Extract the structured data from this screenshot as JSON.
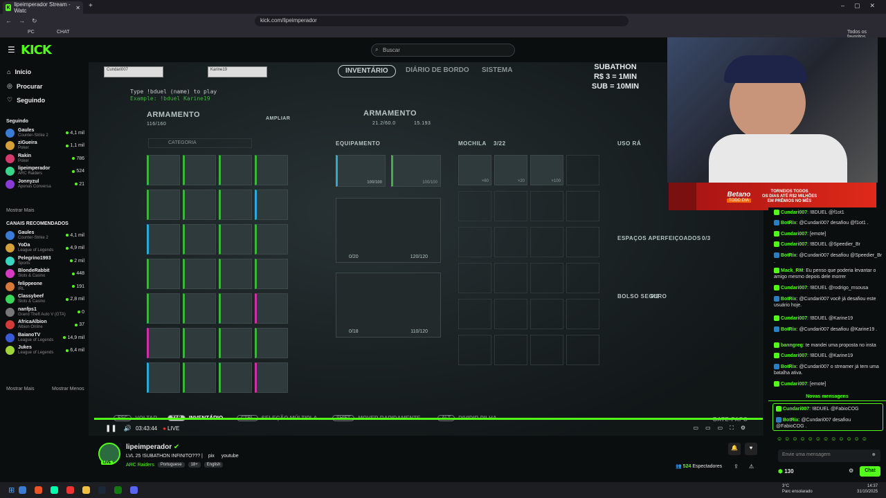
{
  "browser": {
    "tab_title": "lipeimperador Stream - Watc",
    "url": "kick.com/lipeimperador",
    "favorites": "Todos os favoritos",
    "bookmarks": [
      "PC",
      "CHAT"
    ]
  },
  "header": {
    "logo": "KICK",
    "search_placeholder": "Buscar"
  },
  "nav": [
    {
      "label": "Início",
      "icon": "home-icon"
    },
    {
      "label": "Procurar",
      "icon": "compass-icon"
    },
    {
      "label": "Seguindo",
      "icon": "heart-icon"
    }
  ],
  "following_title": "Seguindo",
  "following": [
    {
      "name": "Gaules",
      "game": "Counter-Strike 2",
      "viewers": "4,1 mil",
      "color": "#3a7bd5"
    },
    {
      "name": "ziGueira",
      "game": "Poker",
      "viewers": "1,1 mil",
      "color": "#d5a03a"
    },
    {
      "name": "Rakin",
      "game": "Poker",
      "viewers": "786",
      "color": "#d53a6a"
    },
    {
      "name": "lipeimperador",
      "game": "ARC Raiders",
      "viewers": "524",
      "color": "#3ad58a"
    },
    {
      "name": "Jonnyzul",
      "game": "Apenas Conversa",
      "viewers": "21",
      "color": "#8a3ad5"
    }
  ],
  "show_more": "Mostrar Mais",
  "recommended_title": "CANAIS RECOMENDADOS",
  "recommended": [
    {
      "name": "Gaules",
      "game": "Counter-Strike 2",
      "viewers": "4,1 mil",
      "color": "#3a7bd5"
    },
    {
      "name": "YoDa",
      "game": "League of Legends",
      "viewers": "4,9 mil",
      "color": "#d5a03a"
    },
    {
      "name": "Pelegrino1993",
      "game": "Sports",
      "viewers": "2 mil",
      "color": "#3ad5c0"
    },
    {
      "name": "BlondeRabbit",
      "game": "Slots & Casino",
      "viewers": "448",
      "color": "#d53ac0"
    },
    {
      "name": "felippeone",
      "game": "IRL",
      "viewers": "191",
      "color": "#d57a3a"
    },
    {
      "name": "Classybeef",
      "game": "Slots & Casino",
      "viewers": "2,8 mil",
      "color": "#3ad55a"
    },
    {
      "name": "nanfps1",
      "game": "Grand Theft Auto V (GTA)",
      "viewers": "0",
      "color": "#777777"
    },
    {
      "name": "AfricaAlbion",
      "game": "Albion Online",
      "viewers": "37",
      "color": "#d53a3a"
    },
    {
      "name": "BaianoTV",
      "game": "League of Legends",
      "viewers": "14,9 mil",
      "color": "#3a5ad5"
    },
    {
      "name": "Jukes",
      "game": "League of Legends",
      "viewers": "6,4 mil",
      "color": "#a0d53a"
    }
  ],
  "show_more2": "Mostrar Mais",
  "show_less": "Mostrar Menos",
  "game": {
    "tabs": [
      "INVENTÁRIO",
      "DIÁRIO DE BORDO",
      "SISTEMA"
    ],
    "subathon": [
      "SUBATHON",
      "R$ 3 = 1MIN",
      "SUB = 10MIN"
    ],
    "hint1": "Type !bduel (name) to play",
    "hint2": "Example: !bduel Karine19",
    "left_title": "ARMAMENTO",
    "left_count": "116/160",
    "expand": "AMPLIAR",
    "category": "CATEGORIA",
    "mid_title": "ARMAMENTO",
    "weight": "21.2/60.0",
    "money": "15.193",
    "equip": "EQUIPAMENTO",
    "backpack": "MOCHILA",
    "backpack_count": "3/22",
    "quick": "USO RÁ",
    "enhanced": "ESPAÇOS APERFEIÇOADOS",
    "enhanced_count": "0/3",
    "safe": "BOLSO SEGURO",
    "safe_count": "0/2",
    "ammo1": "0/20",
    "dur1": "120/120",
    "ammo2": "0/18",
    "dur2": "110/120",
    "equip_dur": "100/100",
    "equip_dur2": "100/100",
    "mochila_q": [
      "×60",
      "×20",
      "×100"
    ],
    "bottom": [
      [
        "ESC",
        "VOLTAR"
      ],
      [
        "TAB",
        "INVENTÁRIO"
      ],
      [
        "CTRL",
        "SELEÇÃO MÚLTIPLA"
      ],
      [
        "SHIFT",
        "MOVER RAPIDAMENTE"
      ],
      [
        "ALT",
        "DIVIDIR PILHA"
      ]
    ],
    "bate": "BATE-PAPO",
    "hp1": "Cundari007",
    "hp2": "Karine19"
  },
  "player": {
    "time": "03:43:44",
    "live": "LIVE"
  },
  "banner": {
    "brand": "Betano",
    "sub": "TODO DIA",
    "text1": "TORNEIOS TODOS",
    "text2": "OS DIAS ATÉ R$2 MILHÕES",
    "text3": "EM PRÊMIOS NO MÊS"
  },
  "chat": [
    {
      "user": "Cundari007",
      "text": "!BDUEL @f1ot1"
    },
    {
      "user": "BotRix",
      "text": "@Cundari007 desafiou @f1ot1 .",
      "bot": true
    },
    {
      "user": "Cundari007",
      "text": "[emote]"
    },
    {
      "user": "Cundari007",
      "text": "!BDUEL @Speedier_Br"
    },
    {
      "user": "BotRix",
      "text": "@Cundari007 desafiou @Speedier_Br .",
      "bot": true
    },
    {
      "user": "Mack_RM",
      "text": "Eu penso que poderia levantar o amigo mesmo depois dele morrer"
    },
    {
      "user": "Cundari007",
      "text": "!BDUEL @rodrigo_msousa"
    },
    {
      "user": "BotRix",
      "text": "@Cundari007 você já desafiou este usuário hoje.",
      "bot": true
    },
    {
      "user": "Cundari007",
      "text": "!BDUEL @Karine19"
    },
    {
      "user": "BotRix",
      "text": "@Cundari007 desafiou @Karine19 .",
      "bot": true
    },
    {
      "user": "banngreg",
      "text": "te mandei uma proposta no insta"
    },
    {
      "user": "Cundari007",
      "text": "!BDUEL @Karine19"
    },
    {
      "user": "BotRix",
      "text": "@Cundari007 o streamer já tem uma batalha ativa.",
      "bot": true
    },
    {
      "user": "Cundari007",
      "text": "[emote]"
    }
  ],
  "new_messages": "Novas mensagens",
  "pinned": [
    {
      "user": "Cundari007",
      "text": "!BDUEL @FabioCOG"
    },
    {
      "user": "BotRix",
      "text": "@Cundari007 desafiou @FabioCOG .",
      "bot": true
    }
  ],
  "chat_placeholder": "Envie uma mensagem",
  "points": "130",
  "chat_button": "Chat",
  "stream": {
    "name": "lipeimperador",
    "title": "LVL 25 !SUBATHON INFINITO??? |",
    "link1": "pix",
    "link2": "youtube",
    "category": "ARC Raiders",
    "tags": [
      "Portuguese",
      "18+",
      "English"
    ],
    "viewers": "524",
    "viewers_label": "Espectadores",
    "live": "LIVE"
  },
  "taskbar": {
    "temp": "3°C",
    "weather": "Parc ensolarado",
    "time": "14:37",
    "date": "31/10/2025"
  }
}
